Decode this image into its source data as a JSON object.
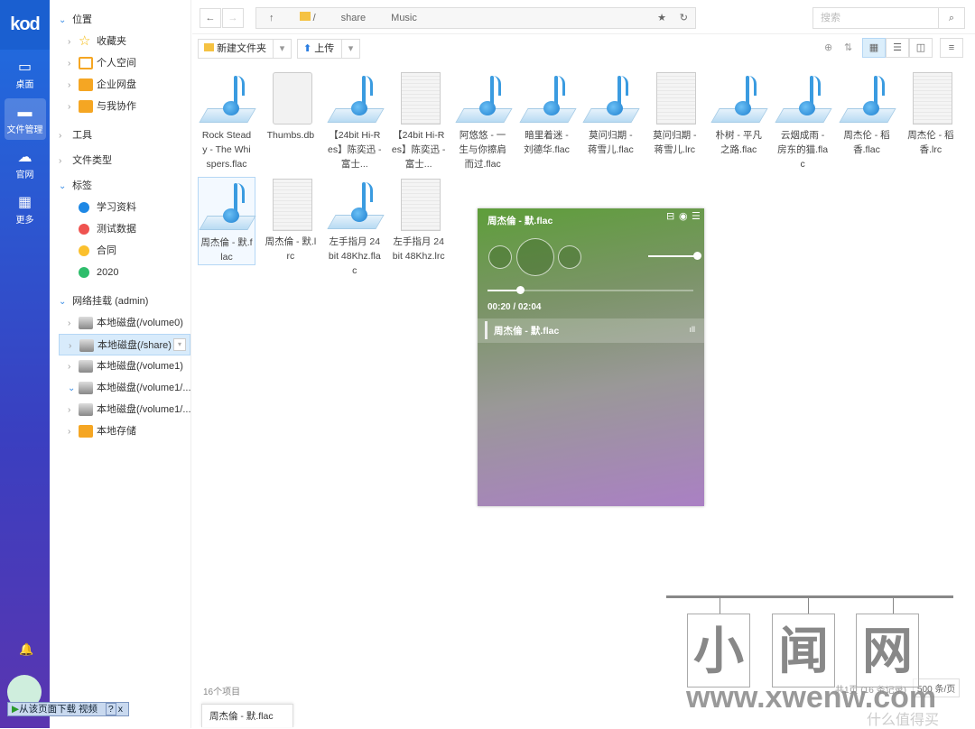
{
  "app": {
    "logo": "kod"
  },
  "rail": [
    {
      "label": "桌面",
      "icon": "monitor-icon"
    },
    {
      "label": "文件管理",
      "icon": "folder-icon",
      "active": true
    },
    {
      "label": "官网",
      "icon": "cloud-icon"
    },
    {
      "label": "更多",
      "icon": "grid-icon"
    }
  ],
  "tree": {
    "location": "位置",
    "favorites": "收藏夹",
    "personal": "个人空间",
    "enterprise": "企业网盘",
    "shared": "与我协作",
    "tools": "工具",
    "filetypes": "文件类型",
    "tags": "标签",
    "tag_items": [
      {
        "label": "学习资料",
        "color": "#1e88e5"
      },
      {
        "label": "测试数据",
        "color": "#ef5350"
      },
      {
        "label": "合同",
        "color": "#fbc02d"
      },
      {
        "label": "2020",
        "color": "#2ebd6b"
      }
    ],
    "mount": "网络挂载 (admin)",
    "mounts": [
      "本地磁盘(/volume0)",
      "本地磁盘(/share)",
      "本地磁盘(/volume1)",
      "本地磁盘(/volume1/....",
      "本地磁盘(/volume1/....",
      "本地存储"
    ]
  },
  "breadcrumb": [
    "/",
    "share",
    "Music"
  ],
  "search": {
    "placeholder": "搜索"
  },
  "toolbar": {
    "new_folder": "新建文件夹",
    "upload": "上传"
  },
  "files": [
    {
      "name": "Rock Steady - The Whispers.flac",
      "display": "Rock Stead y - The Whi spers.flac",
      "type": "flac"
    },
    {
      "name": "Thumbs.db",
      "display": "Thumbs.db",
      "type": "db"
    },
    {
      "name": "【24bit Hi-Res】陈奕迅 - 富士...",
      "display": "【24bit Hi-Res】陈奕迅 - 富士...",
      "type": "flac"
    },
    {
      "name": "【24bit Hi-Res】陈奕迅 - 富士...",
      "display": "【24bit Hi-Res】陈奕迅 - 富士...",
      "type": "lrc"
    },
    {
      "name": "阿悠悠 - 一生与你擦肩而过.flac",
      "display": "阿悠悠 - 一生与你擦肩而过.flac",
      "type": "flac"
    },
    {
      "name": "暗里着迷 - 刘德华.flac",
      "display": "暗里着迷 - 刘德华.flac",
      "type": "flac"
    },
    {
      "name": "莫问归期 - 蒋雪儿.flac",
      "display": "莫问归期 - 蒋雪儿.flac",
      "type": "flac"
    },
    {
      "name": "莫问归期 - 蒋雪儿.lrc",
      "display": "莫问归期 - 蒋雪儿.lrc",
      "type": "lrc"
    },
    {
      "name": "朴树 - 平凡之路.flac",
      "display": "朴树 - 平凡之路.flac",
      "type": "flac"
    },
    {
      "name": "云烟成雨 - 房东的猫.flac",
      "display": "云烟成雨 - 房东的猫.flac",
      "type": "flac"
    },
    {
      "name": "周杰伦 - 稻香.flac",
      "display": "周杰伦 - 稻香.flac",
      "type": "flac"
    },
    {
      "name": "周杰伦 - 稻香.lrc",
      "display": "周杰伦 - 稻香.lrc",
      "type": "lrc"
    },
    {
      "name": "周杰倫 - 默.flac",
      "display": "周杰倫 - 默.flac",
      "type": "flac",
      "selected": true
    },
    {
      "name": "周杰倫 - 默.lrc",
      "display": "周杰倫 - 默.lrc",
      "type": "lrc"
    },
    {
      "name": "左手指月 24bit 48Khz.flac",
      "display": "左手指月 24bit 48Khz.flac",
      "type": "flac"
    },
    {
      "name": "左手指月 24bit 48Khz.lrc",
      "display": "左手指月 24bit 48Khz.lrc",
      "type": "lrc"
    }
  ],
  "player": {
    "title": "周杰倫 - 默.flac",
    "time": "00:20 / 02:04",
    "progress": 0.16,
    "volume": 1.0,
    "playlist": [
      "周杰倫 - 默.flac"
    ]
  },
  "footer": {
    "count": "16个项目",
    "pages": "共1页 (16 条记录)",
    "per_page": "500 条/页"
  },
  "taskbar": {
    "active": "周杰倫 - 默.flac"
  },
  "download_bar": {
    "label": "从该页面下载 视频",
    "help": "?",
    "close": "x"
  },
  "watermark": {
    "chars": [
      "小",
      "闻",
      "网"
    ],
    "url": "www.xwenw.com",
    "corner": "什么值得买"
  }
}
